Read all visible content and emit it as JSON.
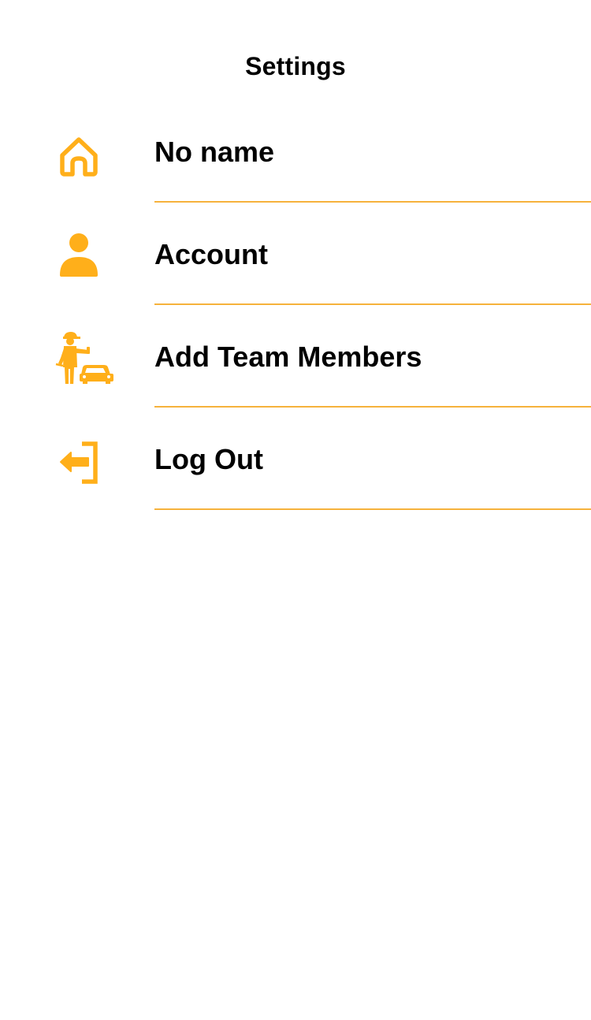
{
  "header": {
    "title": "Settings"
  },
  "theme": {
    "accent": "#FFAF1A",
    "divider": "#F6B23C",
    "text": "#000000",
    "background": "#FFFFFF"
  },
  "menu": {
    "items": [
      {
        "label": "No name",
        "icon": "home-icon"
      },
      {
        "label": "Account",
        "icon": "person-icon"
      },
      {
        "label": "Add Team Members",
        "icon": "mechanic-car-icon"
      },
      {
        "label": "Log Out",
        "icon": "logout-icon"
      }
    ]
  }
}
